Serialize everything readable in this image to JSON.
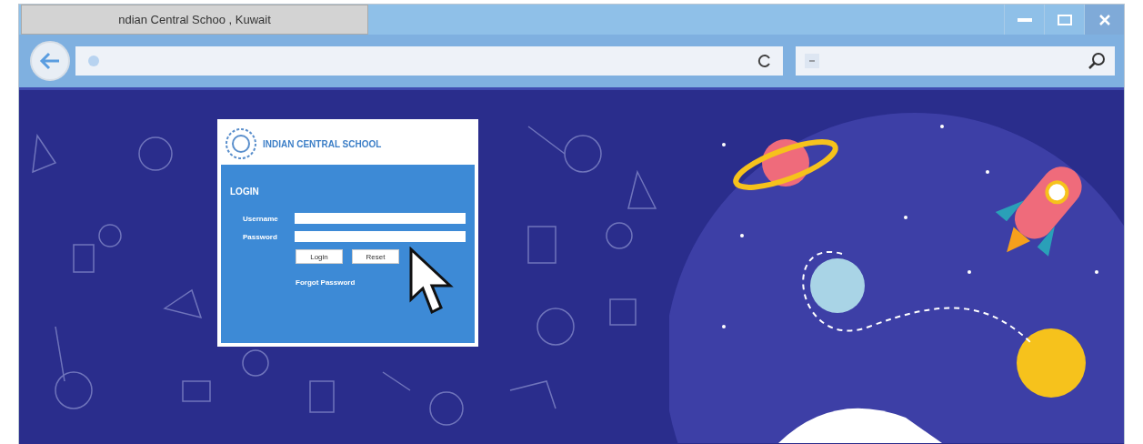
{
  "browser": {
    "tab_title": "ndian Central Schoo , Kuwait"
  },
  "login": {
    "school_name": "INDIAN CENTRAL SCHOOL",
    "heading": "LOGIN",
    "fields": [
      {
        "label": "Username"
      },
      {
        "label": "Password"
      }
    ],
    "buttons": [
      "Login",
      "Reset"
    ],
    "link": "Forgot Password"
  }
}
